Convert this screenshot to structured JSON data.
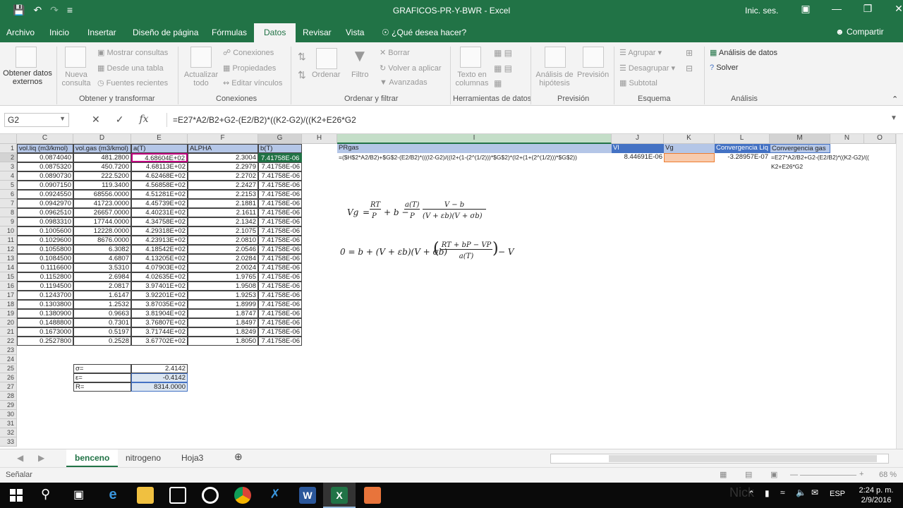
{
  "window": {
    "title": "GRAFICOS-PR-Y-BWR - Excel",
    "signin": "Inic. ses.",
    "qat": [
      "save-icon",
      "undo-icon",
      "redo-icon",
      "customize-icon"
    ]
  },
  "tabs": [
    "Archivo",
    "Inicio",
    "Insertar",
    "Diseño de página",
    "Fórmulas",
    "Datos",
    "Revisar",
    "Vista"
  ],
  "tell_me": "¿Qué desea hacer?",
  "share": "Compartir",
  "ribbon": {
    "get_external": "Obtener datos externos",
    "new_query": "Nueva consulta",
    "show_queries": "Mostrar consultas",
    "from_table": "Desde una tabla",
    "recent_sources": "Fuentes recientes",
    "group1": "Obtener y transformar",
    "refresh_all": "Actualizar todo",
    "connections": "Conexiones",
    "properties": "Propiedades",
    "edit_links": "Editar vínculos",
    "group2": "Conexiones",
    "sort": "Ordenar",
    "filter": "Filtro",
    "clear": "Borrar",
    "reapply": "Volver a aplicar",
    "advanced": "Avanzadas",
    "group3": "Ordenar y filtrar",
    "text_to_columns": "Texto en columnas",
    "group4": "Herramientas de datos",
    "what_if": "Análisis de hipótesis",
    "forecast": "Previsión",
    "group5": "Previsión",
    "group_btn": "Agrupar",
    "ungroup": "Desagrupar",
    "subtotal": "Subtotal",
    "group6": "Esquema",
    "data_analysis": "Análisis de datos",
    "solver": "Solver",
    "group7": "Análisis"
  },
  "formula_bar": {
    "name_box": "G2",
    "formula": "=E27*A2/B2+G2-(E2/B2)*((K2-G2)/((K2+E26*G2"
  },
  "columns": [
    "C",
    "D",
    "E",
    "F",
    "G",
    "H",
    "I",
    "J",
    "K",
    "L",
    "M",
    "N",
    "O"
  ],
  "headers_row1": {
    "C": "vol.liq (m3/kmol)",
    "D": "vol.gas (m3/kmol)",
    "E": "a(T)",
    "F": "ALPHA",
    "G": "b(T)",
    "I": "PRgas",
    "J": "Vl",
    "K": "Vg",
    "L": "Convergencia Liq",
    "M": "Convergencia gas"
  },
  "row2_extra": {
    "I": "=($H$2*A2/B2)+$G$2-(E2/B2)*(((I2-G2)/((I2+(1-(2^(1/2)))*$G$2)*(I2+(1+(2^(1/2)))*$G$2))",
    "J": "8.44691E-06",
    "L": "-3.28957E-07",
    "M1": "=E27*A2/B2+G2-(E2/B2)*((K2-G2)/((",
    "M2": "K2+E26*G2"
  },
  "rows": [
    {
      "r": "2",
      "C": "0.0874040",
      "D": "481.2800",
      "E": "4.68604E+02",
      "F": "2.3004",
      "G": "7.41758E-06"
    },
    {
      "r": "3",
      "C": "0.0875320",
      "D": "450.7200",
      "E": "4.68113E+02",
      "F": "2.2979",
      "G": "7.41758E-06"
    },
    {
      "r": "4",
      "C": "0.0890730",
      "D": "222.5200",
      "E": "4.62468E+02",
      "F": "2.2702",
      "G": "7.41758E-06"
    },
    {
      "r": "5",
      "C": "0.0907150",
      "D": "119.3400",
      "E": "4.56858E+02",
      "F": "2.2427",
      "G": "7.41758E-06"
    },
    {
      "r": "6",
      "C": "0.0924550",
      "D": "68556.0000",
      "E": "4.51281E+02",
      "F": "2.2153",
      "G": "7.41758E-06"
    },
    {
      "r": "7",
      "C": "0.0942970",
      "D": "41723.0000",
      "E": "4.45739E+02",
      "F": "2.1881",
      "G": "7.41758E-06"
    },
    {
      "r": "8",
      "C": "0.0962510",
      "D": "26657.0000",
      "E": "4.40231E+02",
      "F": "2.1611",
      "G": "7.41758E-06"
    },
    {
      "r": "9",
      "C": "0.0983310",
      "D": "17744.0000",
      "E": "4.34758E+02",
      "F": "2.1342",
      "G": "7.41758E-06"
    },
    {
      "r": "10",
      "C": "0.1005600",
      "D": "12228.0000",
      "E": "4.29318E+02",
      "F": "2.1075",
      "G": "7.41758E-06"
    },
    {
      "r": "11",
      "C": "0.1029600",
      "D": "8676.0000",
      "E": "4.23913E+02",
      "F": "2.0810",
      "G": "7.41758E-06"
    },
    {
      "r": "12",
      "C": "0.1055800",
      "D": "6.3082",
      "E": "4.18542E+02",
      "F": "2.0546",
      "G": "7.41758E-06"
    },
    {
      "r": "13",
      "C": "0.1084500",
      "D": "4.6807",
      "E": "4.13205E+02",
      "F": "2.0284",
      "G": "7.41758E-06"
    },
    {
      "r": "14",
      "C": "0.1116600",
      "D": "3.5310",
      "E": "4.07903E+02",
      "F": "2.0024",
      "G": "7.41758E-06"
    },
    {
      "r": "15",
      "C": "0.1152800",
      "D": "2.6984",
      "E": "4.02635E+02",
      "F": "1.9765",
      "G": "7.41758E-06"
    },
    {
      "r": "16",
      "C": "0.1194500",
      "D": "2.0817",
      "E": "3.97401E+02",
      "F": "1.9508",
      "G": "7.41758E-06"
    },
    {
      "r": "17",
      "C": "0.1243700",
      "D": "1.6147",
      "E": "3.92201E+02",
      "F": "1.9253",
      "G": "7.41758E-06"
    },
    {
      "r": "18",
      "C": "0.1303800",
      "D": "1.2532",
      "E": "3.87035E+02",
      "F": "1.8999",
      "G": "7.41758E-06"
    },
    {
      "r": "19",
      "C": "0.1380900",
      "D": "0.9663",
      "E": "3.81904E+02",
      "F": "1.8747",
      "G": "7.41758E-06"
    },
    {
      "r": "20",
      "C": "0.1488800",
      "D": "0.7301",
      "E": "3.76807E+02",
      "F": "1.8497",
      "G": "7.41758E-06"
    },
    {
      "r": "21",
      "C": "0.1673000",
      "D": "0.5197",
      "E": "3.71744E+02",
      "F": "1.8249",
      "G": "7.41758E-06"
    },
    {
      "r": "22",
      "C": "0.2527800",
      "D": "0.2528",
      "E": "3.67702E+02",
      "F": "1.8050",
      "G": "7.41758E-06"
    }
  ],
  "constants": [
    {
      "label": "σ=",
      "value": "2.4142"
    },
    {
      "label": "ε=",
      "value": "-0.4142"
    },
    {
      "label": "R=",
      "value": "8314.0000"
    }
  ],
  "equation1": {
    "lhs": "Vg",
    "term1_num": "RT",
    "term1_den": "P",
    "mid": "+ b −",
    "term2_num": "a(T)",
    "term2_den": "P",
    "term3_num": "V − b",
    "term3_den": "(V + εb)(V + σb)"
  },
  "equation2": {
    "lhs": "0 = b + (V + εb)(V + σb)",
    "frac_num": "RT + bP − VP",
    "frac_den": "a(T)",
    "tail": "− V"
  },
  "sheets": [
    "benceno",
    "nitrogeno",
    "Hoja3"
  ],
  "status": {
    "mode": "Señalar",
    "zoom": "68 %"
  },
  "taskbar": {
    "lang": "ESP",
    "time": "2:24 p. m.",
    "date": "2/9/2016",
    "ghost": "Nick"
  }
}
